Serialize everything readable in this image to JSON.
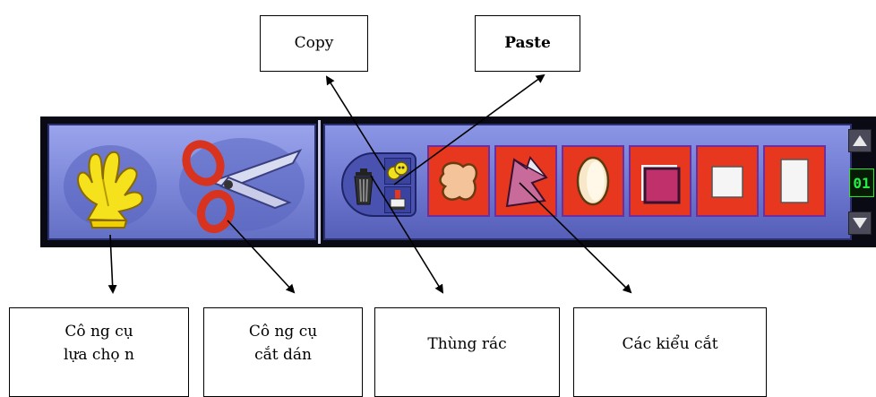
{
  "labels": {
    "copy": "Copy",
    "paste": "Paste",
    "selection_tool": [
      "Cô ng cụ",
      "lựa chọ n"
    ],
    "cut_paste_tool": [
      "Cô ng cụ",
      "cắt dán"
    ],
    "trash": "Thùng rác",
    "cut_styles": "Các kiểu cắt"
  },
  "toolbar": {
    "counter_value": "01",
    "left_tools": [
      {
        "icon": "white-glove-hand-icon",
        "color": "#f3e11a"
      },
      {
        "icon": "scissors-icon",
        "color": "#e0392a"
      }
    ],
    "small_tools": [
      {
        "icon": "trash-can-icon"
      },
      {
        "icon": "copy-icon"
      },
      {
        "icon": "paste-stamp-icon"
      }
    ],
    "cut_styles": [
      {
        "icon": "freeform-blob-icon"
      },
      {
        "icon": "polygon-lasso-icon"
      },
      {
        "icon": "oval-shape-icon"
      },
      {
        "icon": "shaded-square-icon"
      },
      {
        "icon": "white-square-icon"
      },
      {
        "icon": "white-rectangle-icon"
      }
    ],
    "accent_colors": {
      "tile": "#e8371f",
      "tile_border": "#6d2ea0",
      "panel": "#7b86d8"
    }
  }
}
